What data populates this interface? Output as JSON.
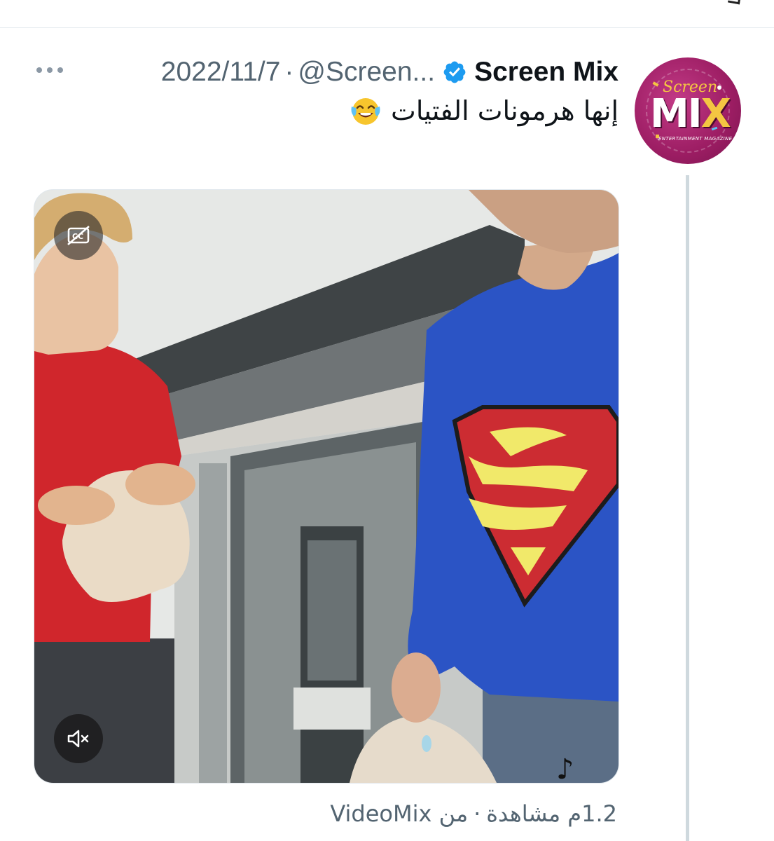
{
  "tweet": {
    "display_name": "Screen Mix",
    "handle": "@Screen...",
    "date": "2022/11/7",
    "separator": "·",
    "text": "إنها هرمونات الفتيات",
    "emoji": "face-with-tears-of-joy-icon",
    "avatar": {
      "script": "Screen",
      "logo_main": "MI",
      "logo_x": "X",
      "subtitle": "ENTERTAINMENT MAGAZINE"
    }
  },
  "media": {
    "type": "video",
    "captions_icon": "captions-off-icon",
    "mute_icon": "muted-speaker-icon"
  },
  "stats": {
    "views": "1.2م مشاهدة",
    "separator": "·",
    "source_prefix": "من",
    "source": "VideoMix"
  },
  "colors": {
    "verified": "#1d9bf0",
    "secondary_text": "#536471",
    "primary_text": "#0f1419",
    "thread_line": "#cfd9de"
  }
}
